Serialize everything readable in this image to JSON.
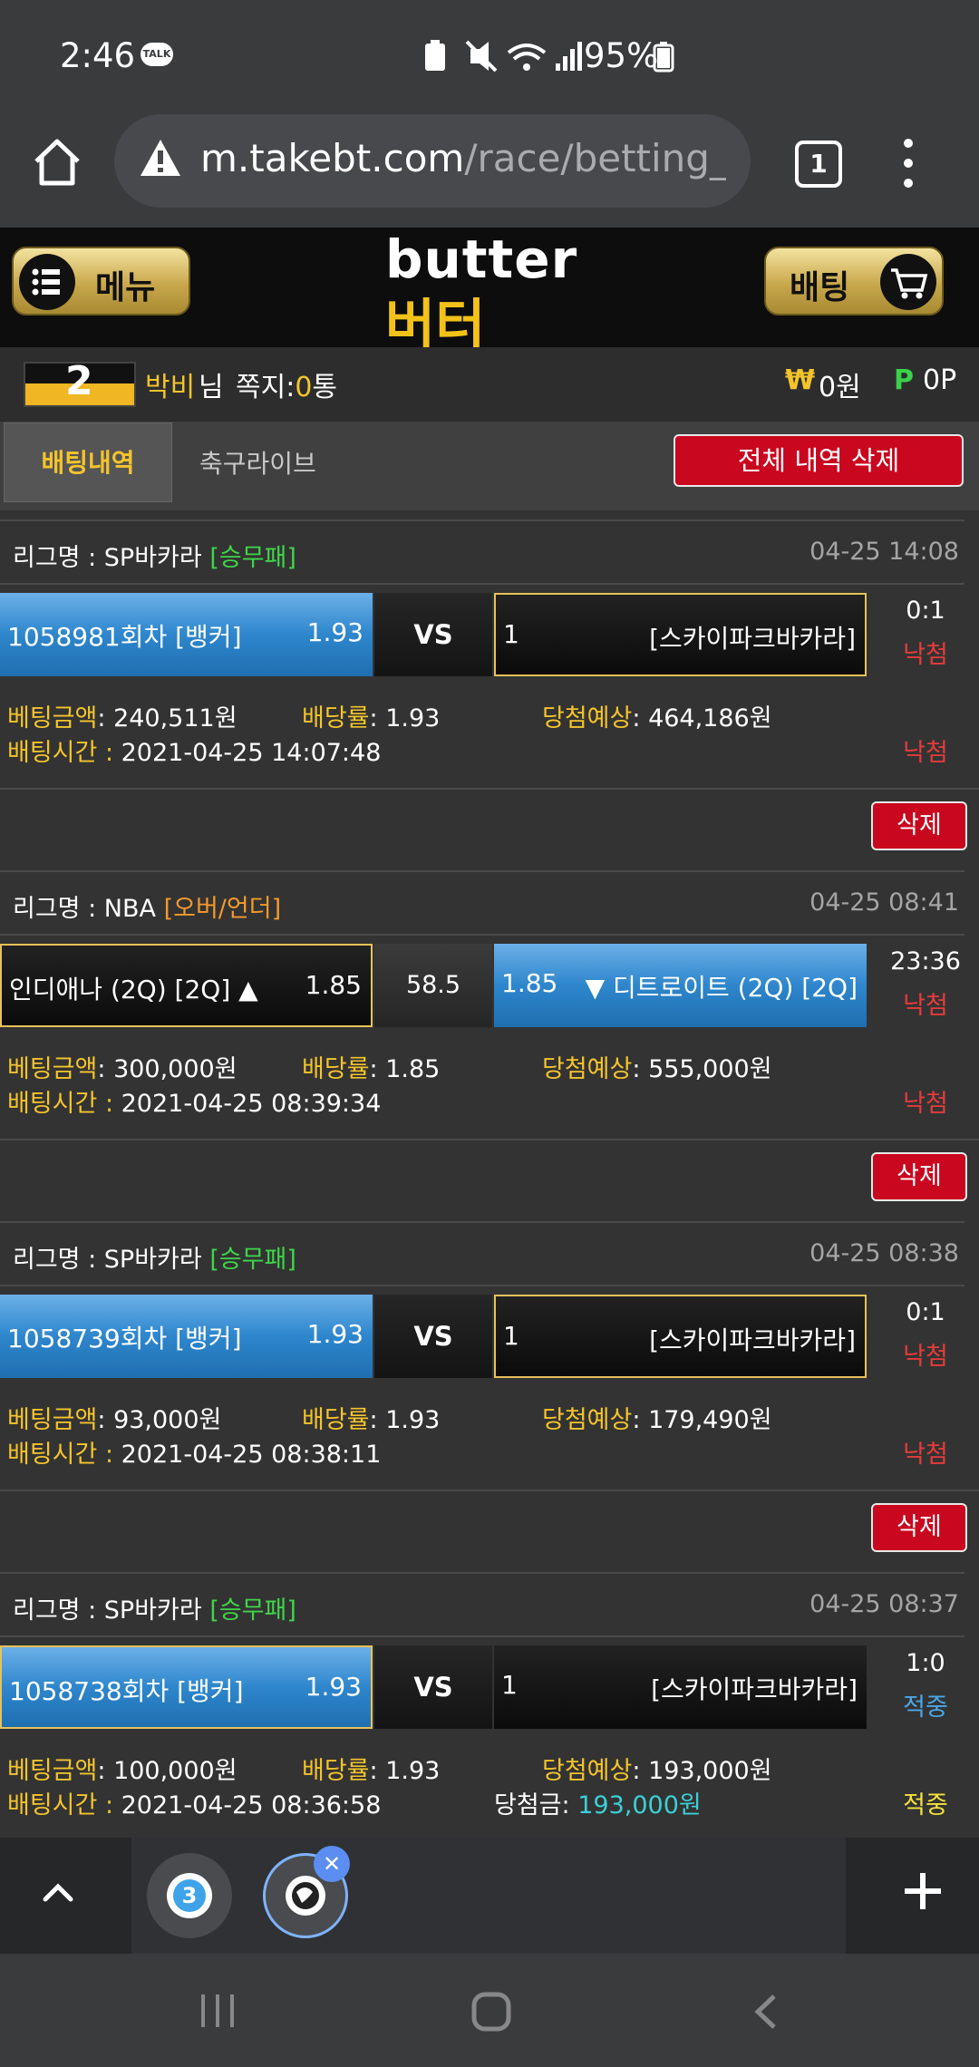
{
  "status_bar": {
    "time": "2:46",
    "talk_badge": "TALK",
    "battery": "95%"
  },
  "browser": {
    "url_host": "m.takebt.com",
    "url_path": "/race/betting_l",
    "tab_count": "1"
  },
  "site": {
    "menu_label": "메뉴",
    "bet_label": "배팅",
    "logo_en": "butter",
    "logo_ko": "버터"
  },
  "user": {
    "avatar_text": "2",
    "name": "박비",
    "name_suffix": "님",
    "messages_label": "쪽지:",
    "messages_count": "0",
    "messages_unit": "통",
    "won_symbol": "₩",
    "money": "0원",
    "point_symbol": "P",
    "points": "0P"
  },
  "tabs": {
    "active": "배팅내역",
    "other": "축구라이브",
    "delete_all": "전체 내역 삭제"
  },
  "labels": {
    "league": "리그명 : ",
    "bet_amount": "베팅금액",
    "odds": "배당률",
    "expected": "당첨예상",
    "bet_time": "배팅시간 : ",
    "win_amount": "당첨금",
    "delete": "삭제",
    "vs": "VS"
  },
  "bets": [
    {
      "league": "SP바카라",
      "type": "[승무패]",
      "datetime": "04-25 14:08",
      "home": "1058981회차 [뱅커]",
      "home_odds": "1.93",
      "mid": "VS",
      "away_num": "1",
      "away": "[스카이파크바카라]",
      "score": "0:1",
      "status": "낙첨",
      "amount": "240,511원",
      "odds": "1.93",
      "expected": "464,186원",
      "time": "2021-04-25 14:07:48",
      "final": "낙첨"
    },
    {
      "league": "NBA",
      "type": "[오버/언더]",
      "datetime": "04-25 08:41",
      "home": "인디애나 (2Q) [2Q] ▲",
      "home_odds": "1.85",
      "mid": "58.5",
      "away_odds": "1.85",
      "away": "▼ 디트로이트 (2Q) [2Q]",
      "score": "23:36",
      "status": "낙첨",
      "amount": "300,000원",
      "odds": "1.85",
      "expected": "555,000원",
      "time": "2021-04-25 08:39:34",
      "final": "낙첨"
    },
    {
      "league": "SP바카라",
      "type": "[승무패]",
      "datetime": "04-25 08:38",
      "home": "1058739회차 [뱅커]",
      "home_odds": "1.93",
      "mid": "VS",
      "away_num": "1",
      "away": "[스카이파크바카라]",
      "score": "0:1",
      "status": "낙첨",
      "amount": "93,000원",
      "odds": "1.93",
      "expected": "179,490원",
      "time": "2021-04-25 08:38:11",
      "final": "낙첨"
    },
    {
      "league": "SP바카라",
      "type": "[승무패]",
      "datetime": "04-25 08:37",
      "home": "1058738회차 [뱅커]",
      "home_odds": "1.93",
      "mid": "VS",
      "away_num": "1",
      "away": "[스카이파크바카라]",
      "score": "1:0",
      "status": "적중",
      "amount": "100,000원",
      "odds": "1.93",
      "expected": "193,000원",
      "time": "2021-04-25 08:36:58",
      "win_amount": "193,000원",
      "final": "적중"
    }
  ],
  "colors": {
    "gold": "#f4c42c",
    "red": "#c9071f",
    "blue": "#2e86cc",
    "green": "#3fd54a"
  }
}
